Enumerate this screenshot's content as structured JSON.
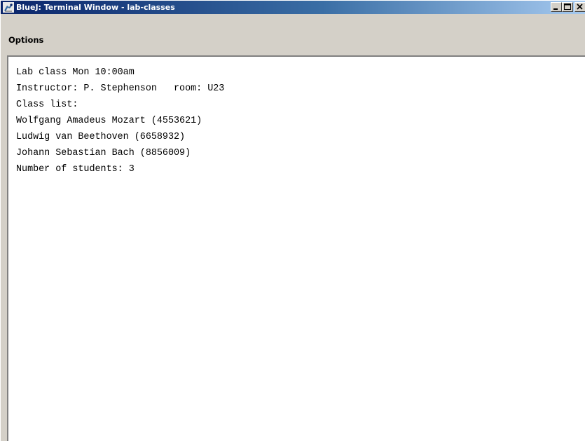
{
  "window": {
    "title": "BlueJ: Terminal Window - lab-classes"
  },
  "menu": {
    "options_label": "Options"
  },
  "terminal": {
    "lines": [
      "Lab class Mon 10:00am",
      "Instructor: P. Stephenson   room: U23",
      "Class list:",
      "Wolfgang Amadeus Mozart (4553621)",
      "Ludwig van Beethoven (6658932)",
      "Johann Sebastian Bach (8856009)",
      "Number of students: 3"
    ]
  },
  "colors": {
    "titlebar_start": "#0a246a",
    "titlebar_end": "#a6caf0",
    "window_face": "#d4d0c8",
    "terminal_bg": "#ffffff"
  },
  "icons": {
    "app": "bluej-bird-icon",
    "minimize": "minimize-icon",
    "maximize": "maximize-icon",
    "close": "close-icon"
  }
}
